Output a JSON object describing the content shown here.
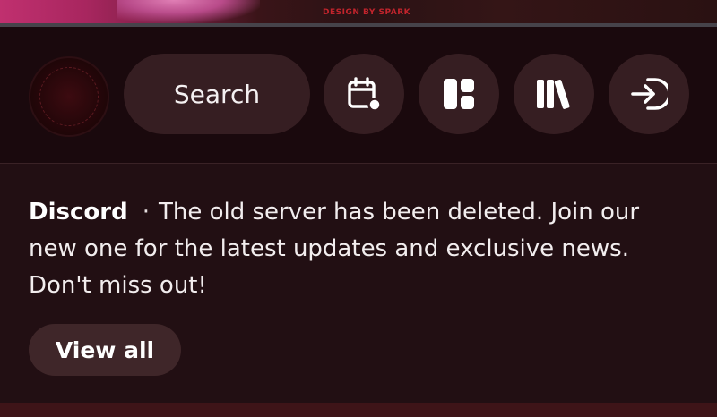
{
  "banner": {
    "credit": "DESIGN BY SPARK"
  },
  "nav": {
    "logo_alt": "site-logo",
    "search_label": "Search",
    "buttons": [
      {
        "icon": "calendar-icon"
      },
      {
        "icon": "layout-dashboard-icon"
      },
      {
        "icon": "library-icon"
      },
      {
        "icon": "login-icon"
      }
    ]
  },
  "announcement": {
    "source": "Discord",
    "separator": "·",
    "message": "The old server has been deleted. Join our new one for the latest updates and exclusive news. Don't miss out!",
    "view_all_label": "View all"
  },
  "colors": {
    "background": "#1c0c10",
    "pill": "#361e22",
    "announcement_bg": "#220f13",
    "view_all_bg": "#3f2629",
    "credit_red": "#c2242c"
  }
}
